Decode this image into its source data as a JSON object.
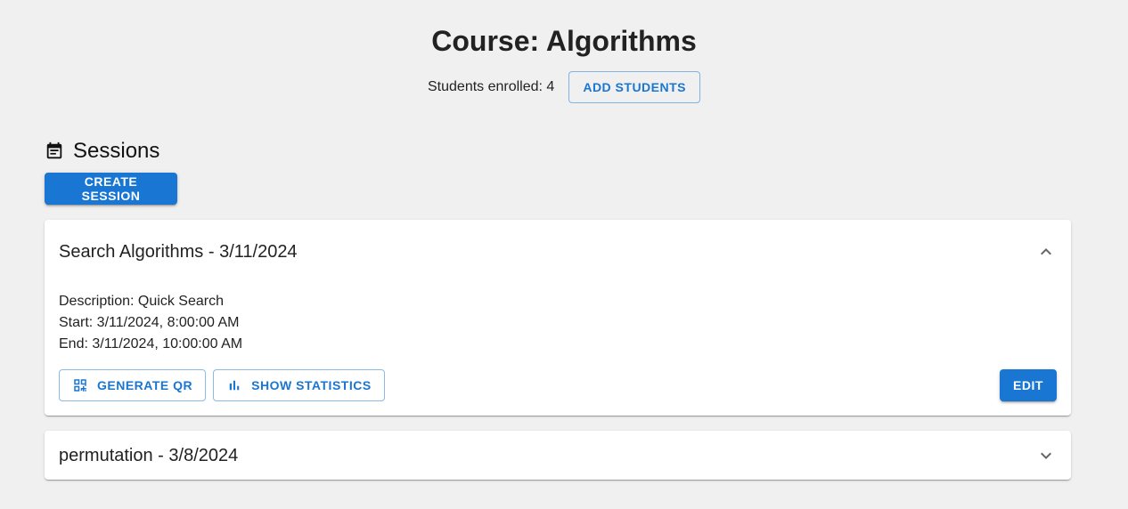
{
  "header": {
    "title": "Course: Algorithms",
    "enrolled_text": "Students enrolled: 4",
    "add_students_label": "ADD STUDENTS"
  },
  "sessions": {
    "heading": "Sessions",
    "heading_icon": "calendar-icon",
    "create_label": "CREATE SESSION",
    "items": [
      {
        "title": "Search Algorithms - 3/11/2024",
        "expanded": true,
        "description": "Description: Quick Search",
        "start": "Start: 3/11/2024, 8:00:00 AM",
        "end": "End: 3/11/2024, 10:00:00 AM",
        "generate_qr_label": "GENERATE QR",
        "generate_qr_icon": "qr-code-icon",
        "show_stats_label": "SHOW STATISTICS",
        "show_stats_icon": "bar-chart-icon",
        "edit_label": "EDIT",
        "toggle_icon": "chevron-up-icon"
      },
      {
        "title": "permutation - 3/8/2024",
        "expanded": false,
        "toggle_icon": "chevron-down-icon"
      }
    ]
  },
  "colors": {
    "primary": "#1976d2",
    "background": "#f0f0f0",
    "card": "#ffffff",
    "text": "#222222"
  }
}
